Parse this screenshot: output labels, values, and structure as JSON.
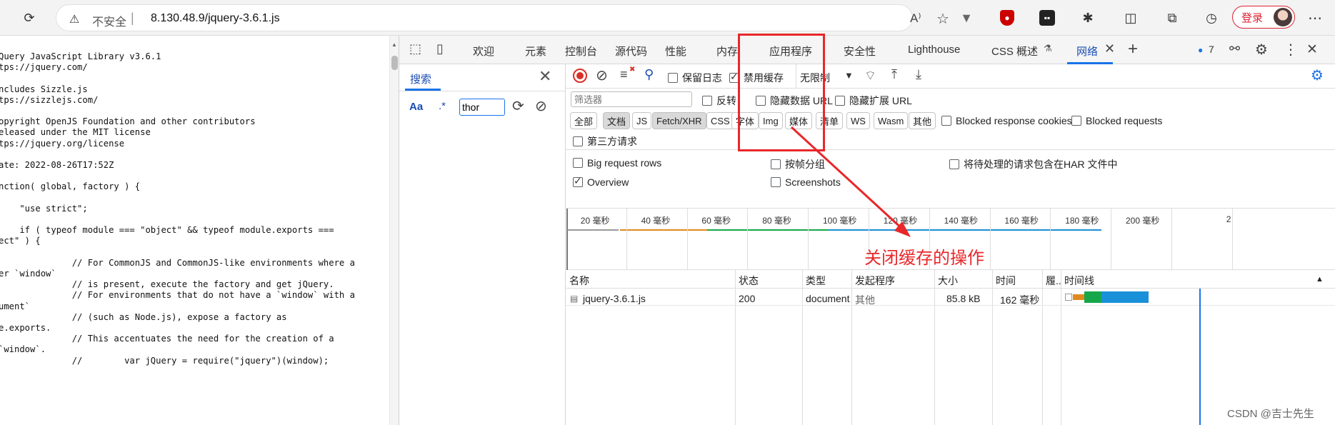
{
  "browser": {
    "insecure_label": "不安全",
    "separator": "|",
    "url": "8.130.48.9/jquery-3.6.1.js",
    "login_label": "登录"
  },
  "code_lines": [
    "Query JavaScript Library v3.6.1",
    "tps://jquery.com/",
    "",
    "ncludes Sizzle.js",
    "tps://sizzlejs.com/",
    "",
    "opyright OpenJS Foundation and other contributors",
    "eleased under the MIT license",
    "tps://jquery.org/license",
    "",
    "ate: 2022-08-26T17:52Z",
    "",
    "nction( global, factory ) {",
    "",
    "    \"use strict\";",
    "",
    "    if ( typeof module === \"object\" && typeof module.exports ===",
    "ect\" ) {",
    "",
    "              // For CommonJS and CommonJS-like environments where a",
    "er `window`",
    "              // is present, execute the factory and get jQuery.",
    "              // For environments that do not have a `window` with a",
    "ument`",
    "              // (such as Node.js), expose a factory as",
    "e.exports.",
    "              // This accentuates the need for the creation of a",
    "`window`.",
    "              //        var jQuery = require(\"jquery\")(window);"
  ],
  "devtools": {
    "tabs": [
      "欢迎",
      "元素",
      "控制台",
      "源代码",
      "性能",
      "内存",
      "应用程序",
      "安全性",
      "Lighthouse",
      "CSS 概述",
      "网络"
    ],
    "issues_count": "7",
    "search": {
      "title": "搜索",
      "case_label": "Aa",
      "regex_label": ".*",
      "query": "thor"
    },
    "toolbar": {
      "preserve_log": "保留日志",
      "disable_cache": "禁用缓存",
      "throttle": "无限制"
    },
    "filter": {
      "placeholder": "筛选器",
      "invert": "反转",
      "hide_data_url": "隐藏数据 URL",
      "hide_ext_url": "隐藏扩展 URL"
    },
    "types": [
      "全部",
      "文档",
      "JS",
      "Fetch/XHR",
      "CSS",
      "字体",
      "Img",
      "媒体",
      "清单",
      "WS",
      "Wasm",
      "其他"
    ],
    "blocked_cookies": "Blocked response cookies",
    "blocked_requests": "Blocked requests",
    "third_party": "第三方请求",
    "options": {
      "big_rows": "Big request rows",
      "group_by_frame": "按帧分组",
      "har_pending": "将待处理的请求包含在HAR 文件中",
      "overview": "Overview",
      "screenshots": "Screenshots"
    },
    "ticks": [
      "20 毫秒",
      "40 毫秒",
      "60 毫秒",
      "80 毫秒",
      "100 毫秒",
      "120 毫秒",
      "140 毫秒",
      "160 毫秒",
      "180 毫秒",
      "200 毫秒",
      "2"
    ],
    "columns": [
      "名称",
      "状态",
      "类型",
      "发起程序",
      "大小",
      "时间",
      "履..",
      "时间线"
    ],
    "rows": [
      {
        "name": "jquery-3.6.1.js",
        "status": "200",
        "type": "document",
        "initiator": "其他",
        "size": "85.8 kB",
        "time": "162 毫秒"
      }
    ]
  },
  "annotation": "关闭缓存的操作",
  "watermark": "CSDN @吉士先生",
  "colors": {
    "accent": "#1a73e8",
    "annotation": "#e8272a",
    "record": "#d93025"
  }
}
